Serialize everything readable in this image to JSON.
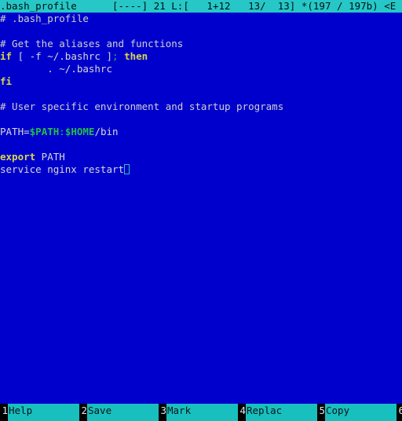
{
  "window": {
    "app": "mcedit",
    "background_color": "#0000cc",
    "accent_color": "#27c7c7"
  },
  "titlebar": {
    "filename": ".bash_profile",
    "spacer1": "      ",
    "modified_flag": "[----]",
    "column_count": "21",
    "line_label": "L:[",
    "position": "   1+12   13/  13]",
    "bytes": "*(197 / 197b)",
    "encoding": "<E"
  },
  "editor": {
    "lines": [
      {
        "tokens": [
          {
            "text": "# .bash_profile",
            "type": "comment"
          }
        ]
      },
      {
        "tokens": [
          {
            "text": "",
            "type": "plain"
          }
        ]
      },
      {
        "tokens": [
          {
            "text": "# Get the aliases and functions",
            "type": "comment"
          }
        ]
      },
      {
        "tokens": [
          {
            "text": "if",
            "type": "keyword"
          },
          {
            "text": " [ -f ~/.bashrc ]",
            "type": "plain"
          },
          {
            "text": ";",
            "type": "punct"
          },
          {
            "text": " ",
            "type": "plain"
          },
          {
            "text": "then",
            "type": "keyword"
          }
        ]
      },
      {
        "tokens": [
          {
            "text": "        . ~/.bashrc",
            "type": "plain"
          }
        ]
      },
      {
        "tokens": [
          {
            "text": "fi",
            "type": "keyword"
          }
        ]
      },
      {
        "tokens": [
          {
            "text": "",
            "type": "plain"
          }
        ]
      },
      {
        "tokens": [
          {
            "text": "# User specific environment and startup programs",
            "type": "comment"
          }
        ]
      },
      {
        "tokens": [
          {
            "text": "",
            "type": "plain"
          }
        ]
      },
      {
        "tokens": [
          {
            "text": "PATH=",
            "type": "plain"
          },
          {
            "text": "$PATH",
            "type": "var"
          },
          {
            "text": ":",
            "type": "punct"
          },
          {
            "text": "$HOME",
            "type": "var"
          },
          {
            "text": "/bin",
            "type": "plain"
          }
        ]
      },
      {
        "tokens": [
          {
            "text": "",
            "type": "plain"
          }
        ]
      },
      {
        "tokens": [
          {
            "text": "export",
            "type": "keyword"
          },
          {
            "text": " PATH",
            "type": "plain"
          }
        ]
      },
      {
        "tokens": [
          {
            "text": "service nginx restart",
            "type": "plain"
          },
          {
            "text": "",
            "type": "cursor"
          }
        ]
      }
    ]
  },
  "function_keys": [
    {
      "number": "1",
      "label": "Help"
    },
    {
      "number": "2",
      "label": "Save"
    },
    {
      "number": "3",
      "label": "Mark"
    },
    {
      "number": "4",
      "label": "Replac"
    },
    {
      "number": "5",
      "label": "Copy"
    },
    {
      "number": "6",
      "label": ""
    }
  ]
}
